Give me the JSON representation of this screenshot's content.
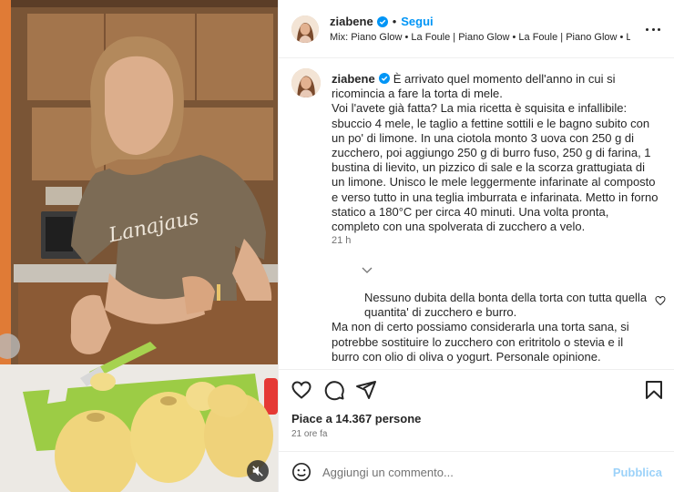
{
  "post": {
    "username": "ziabene",
    "follow_label": "Segui",
    "separator": "•",
    "audio": "Mix: Piano Glow • La Foule | Piano Glow • La Foule | Piano Glow • La F...",
    "verified_icon": "verified-badge-icon",
    "more_icon": "more-options-icon"
  },
  "caption": {
    "username": "ziabene",
    "text": "È arrivato quel momento dell'anno in cui si ricomincia a fare la torta di mele.",
    "body": "Voi l'avete già fatta? La mia ricetta è squisita e infallibile: sbuccio 4 mele, le taglio a fettine sottili e le bagno subito con un po' di limone. In una ciotola monto 3 uova con 250 g di zucchero, poi aggiungo 250 g di burro fuso, 250 g di farina, 1 bustina di lievito, un pizzico di sale e la scorza grattugiata di un limone. Unisco le mele leggermente infarinate al composto e verso tutto in una teglia imburrata e infarinata. Metto in forno statico a 180°C per circa 40 minuti. Una volta pronta, completo con una spolverata di zucchero a velo.",
    "time": "21 h"
  },
  "reply": {
    "line1": "Nessuno dubita della bonta della torta con tutta quella quantita' di zucchero e burro.",
    "line2": "Ma non di certo possiamo considerarla una torta sana, si potrebbe sostituire lo zucchero con eritritolo o stevia e il burro con olio di oliva o yogurt. Personale opinione."
  },
  "actions": {
    "icons": [
      "heart-icon",
      "comment-icon",
      "share-icon",
      "bookmark-icon"
    ],
    "likes": "Piace a 14.367 persone",
    "time_ago": "21 ore fa"
  },
  "add_comment": {
    "placeholder": "Aggiungi un commento...",
    "publish_label": "Pubblica"
  },
  "colors": {
    "accent": "#0095f6",
    "publish_disabled": "#9cd2f9",
    "border": "#efefef",
    "secondary_text": "#737373"
  }
}
